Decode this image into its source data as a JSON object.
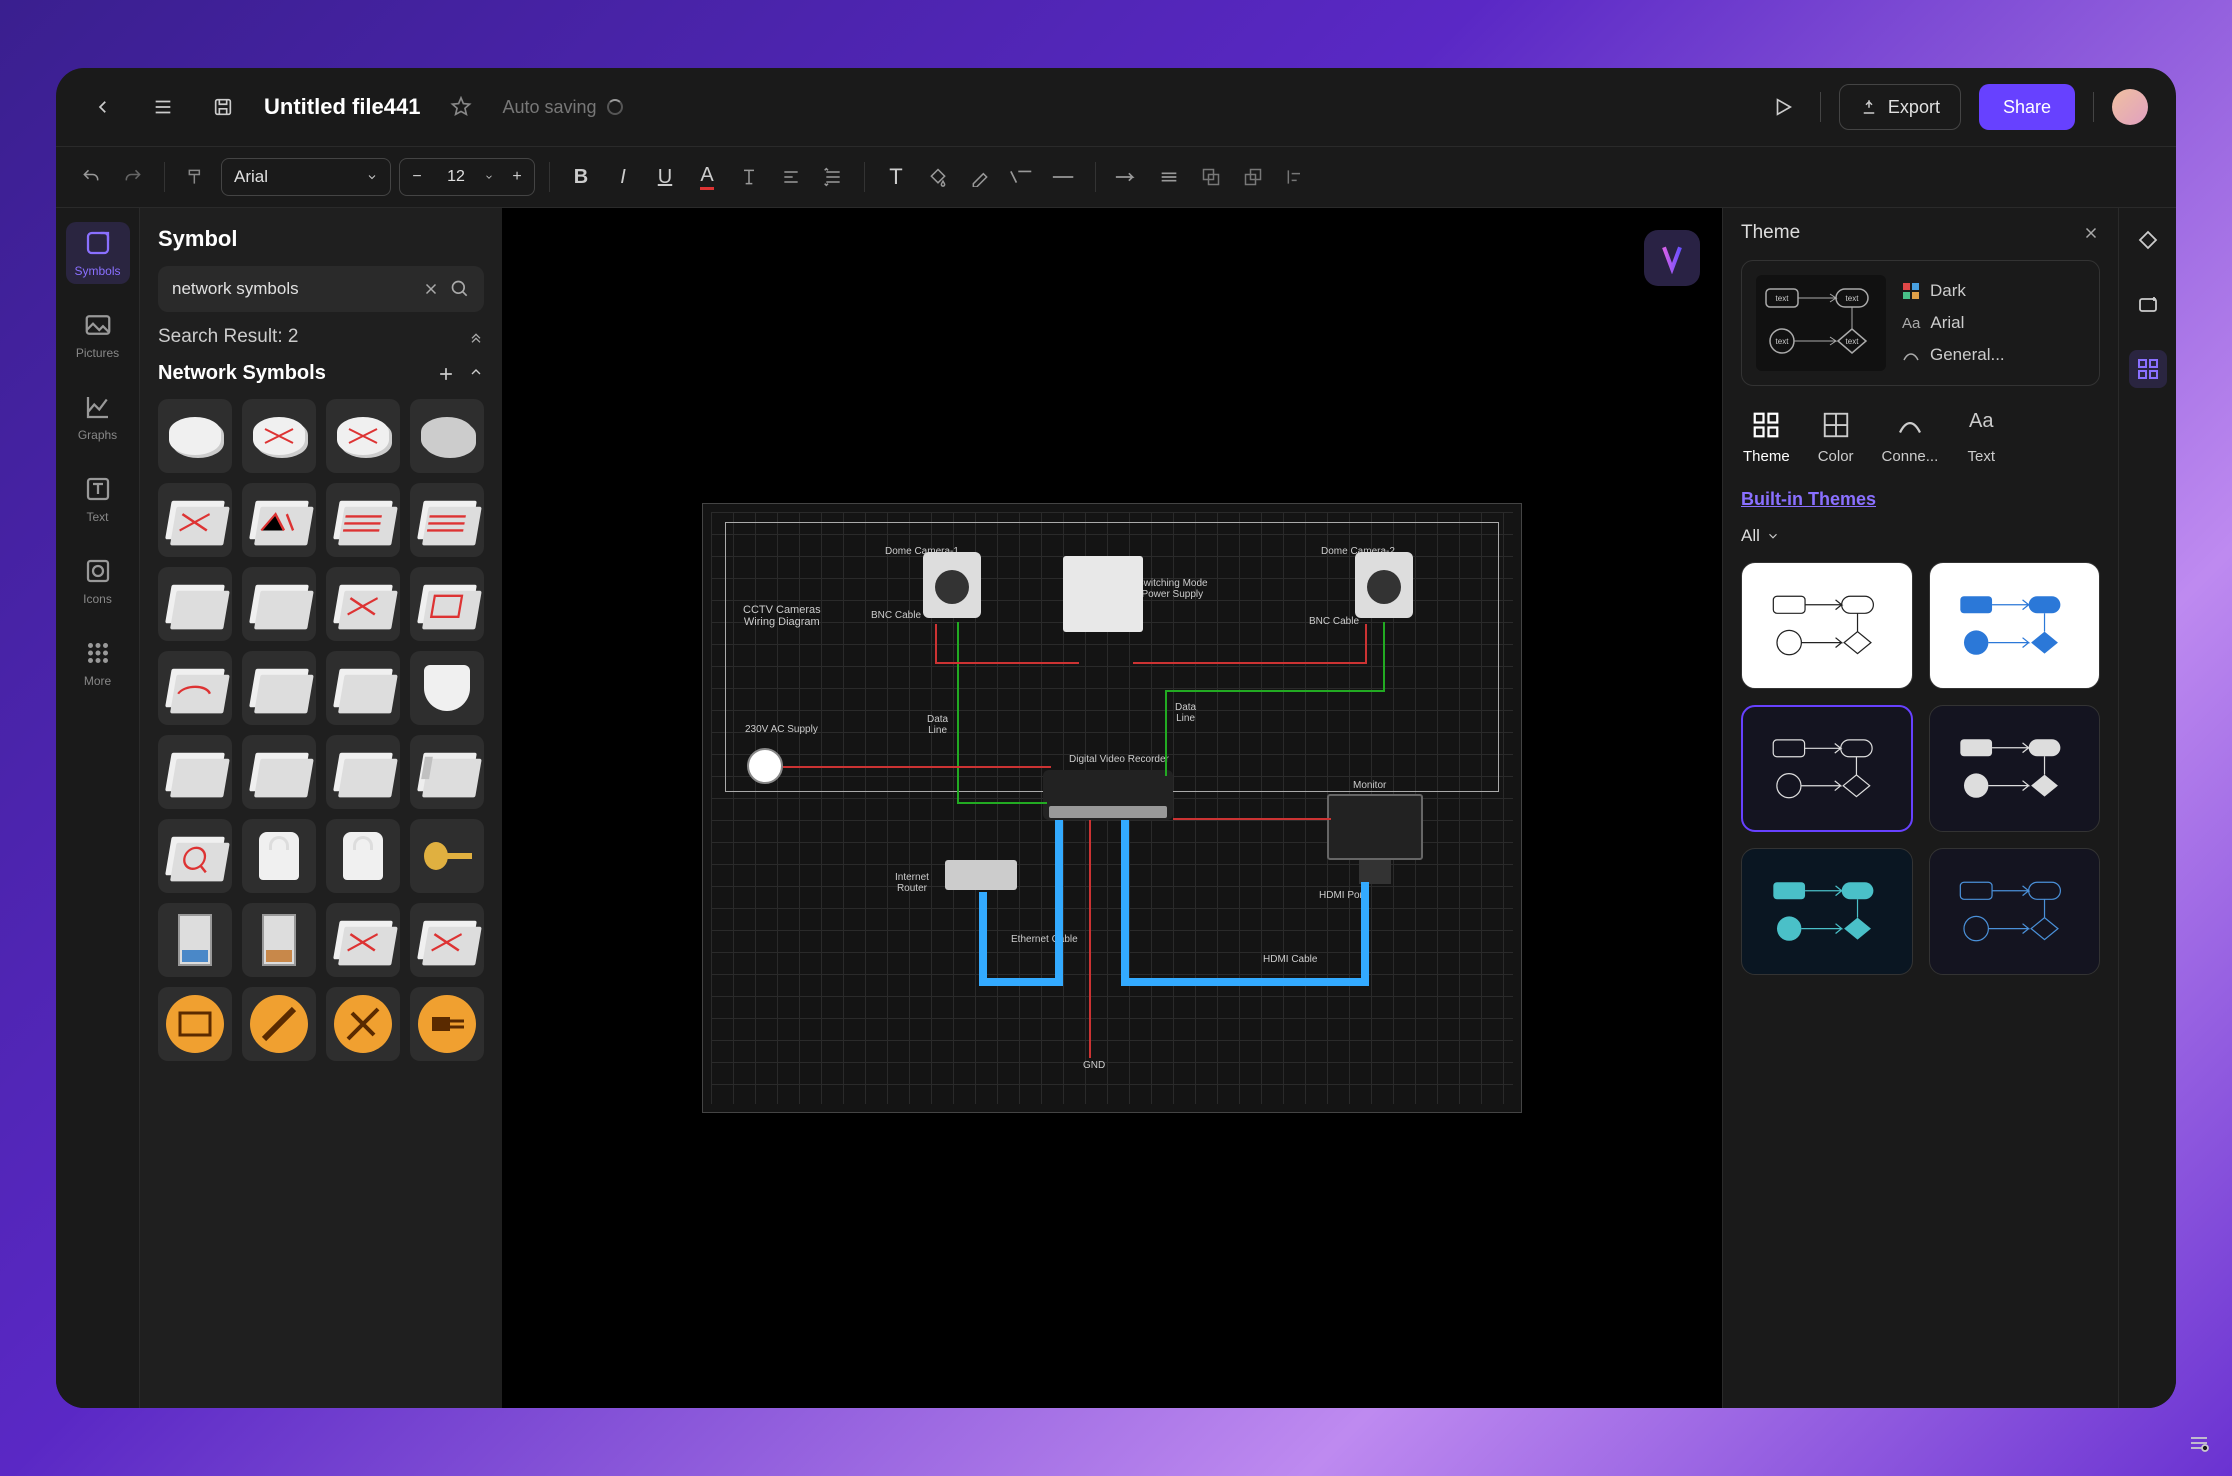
{
  "titlebar": {
    "filename": "Untitled file441",
    "auto_saving": "Auto saving",
    "export": "Export",
    "share": "Share"
  },
  "toolbar": {
    "font": "Arial",
    "font_size": "12"
  },
  "left_rail": {
    "items": [
      "Symbols",
      "Pictures",
      "Graphs",
      "Text",
      "Icons",
      "More"
    ]
  },
  "symbol_panel": {
    "title": "Symbol",
    "search_value": "network symbols",
    "result_text": "Search Result: 2",
    "section_title": "Network Symbols"
  },
  "canvas": {
    "labels": {
      "title": "CCTV Cameras\nWiring Diagram",
      "dome1": "Dome Camera-1",
      "dome2": "Dome Camera-2",
      "psu": "Switching Mode\nPower Supply",
      "bnc1": "BNC Cable",
      "bnc2": "BNC Cable",
      "ac": "230V AC Supply",
      "data1": "Data\nLine",
      "data2": "Data\nLine",
      "dvr": "Digital Video Recorder",
      "monitor": "Monitor",
      "router": "Internet\nRouter",
      "eth": "Ethernet Cable",
      "hdmi_port": "HDMI Port",
      "hdmi_cable": "HDMI Cable",
      "gnd": "GND"
    }
  },
  "right_panel": {
    "title": "Theme",
    "current": {
      "scheme": "Dark",
      "font": "Arial",
      "connector": "General..."
    },
    "tabs": [
      "Theme",
      "Color",
      "Conne...",
      "Text"
    ],
    "section_link": "Built-in Themes",
    "filter": "All"
  }
}
